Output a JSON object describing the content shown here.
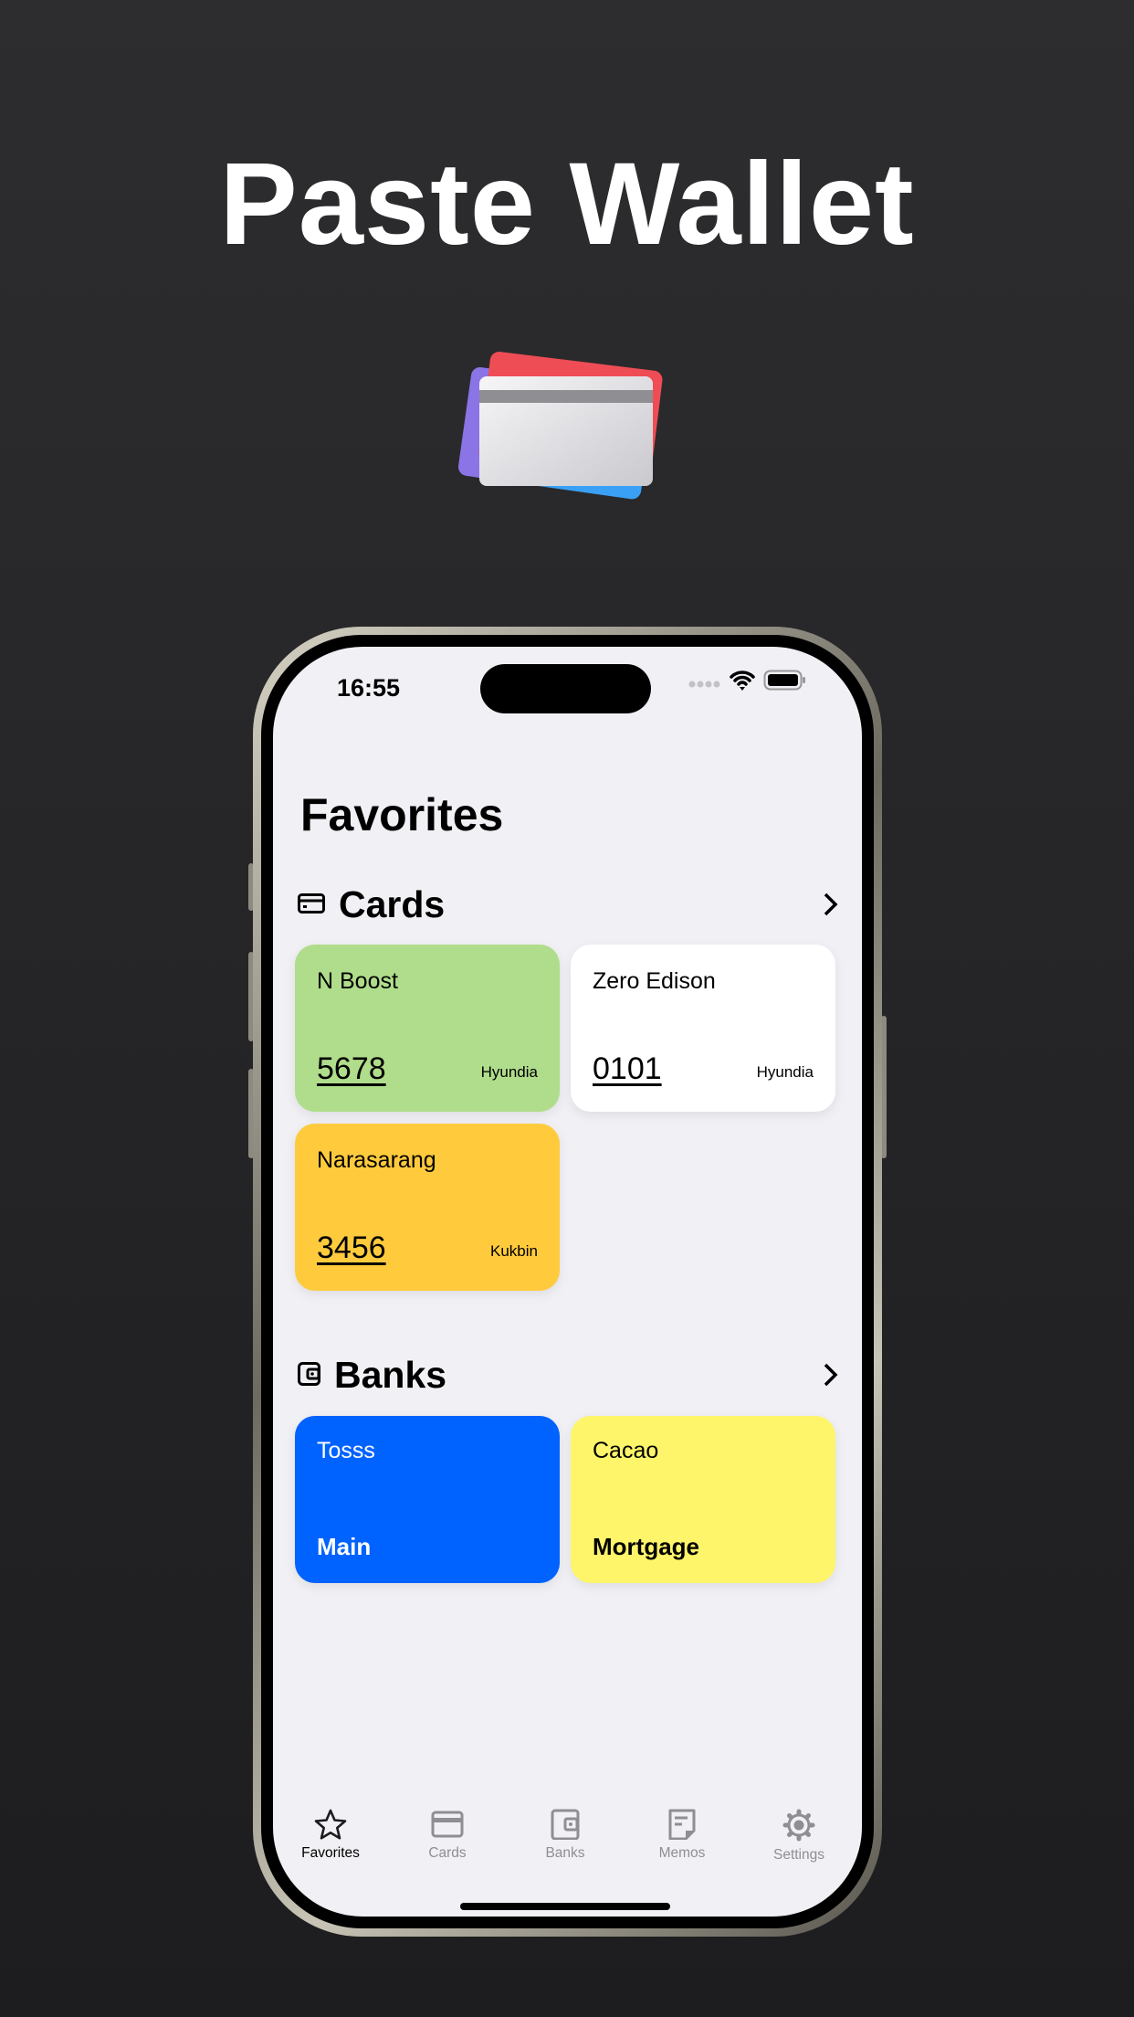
{
  "promo": {
    "title": "Paste Wallet"
  },
  "status_bar": {
    "time": "16:55"
  },
  "page": {
    "title": "Favorites"
  },
  "cards_section": {
    "title": "Cards",
    "items": [
      {
        "name": "N Boost",
        "number": "5678",
        "bank": "Hyundia",
        "color": "#b0dd8b"
      },
      {
        "name": "Zero Edison",
        "number": "0101",
        "bank": "Hyundia",
        "color": "#ffffff"
      },
      {
        "name": "Narasarang",
        "number": "3456",
        "bank": "Kukbin",
        "color": "#ffcb3d"
      }
    ]
  },
  "banks_section": {
    "title": "Banks",
    "items": [
      {
        "name": "Tosss",
        "account": "Main",
        "color": "#0062ff"
      },
      {
        "name": "Cacao",
        "account": "Mortgage",
        "color": "#fff56a"
      }
    ]
  },
  "tab_bar": {
    "active": "Favorites",
    "items": [
      {
        "label": "Favorites",
        "icon": "star-icon"
      },
      {
        "label": "Cards",
        "icon": "credit-card-icon"
      },
      {
        "label": "Banks",
        "icon": "wallet-icon"
      },
      {
        "label": "Memos",
        "icon": "note-icon"
      },
      {
        "label": "Settings",
        "icon": "gear-icon"
      }
    ]
  }
}
